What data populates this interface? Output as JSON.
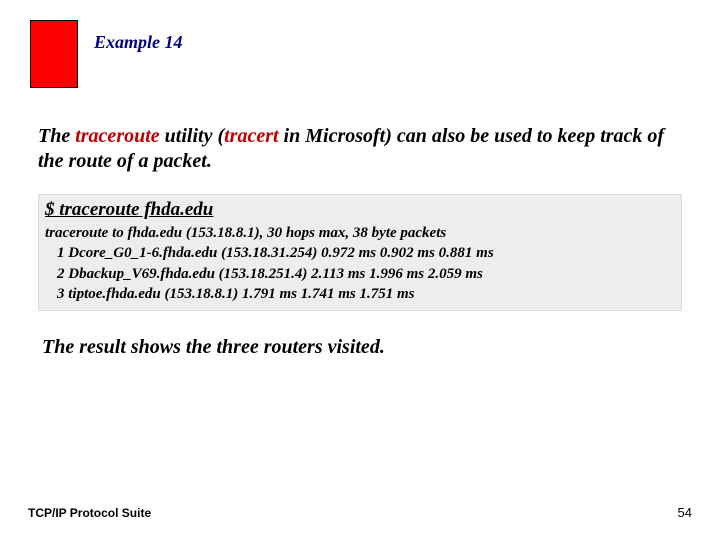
{
  "header": {
    "example_label": "Example 14"
  },
  "intro": {
    "pre": "The ",
    "traceroute_word": "traceroute",
    "mid1": " utility (",
    "tracert_word": "tracert",
    "post": " in Microsoft) can also be used to keep track of the route of a packet."
  },
  "command": {
    "line": "$ traceroute fhda.edu",
    "output_header": "traceroute to fhda.edu (153.18.8.1), 30 hops max, 38 byte packets",
    "hops": [
      "1 Dcore_G0_1-6.fhda.edu (153.18.31.254) 0.972 ms 0.902 ms 0.881 ms",
      "2 Dbackup_V69.fhda.edu (153.18.251.4) 2.113 ms 1.996 ms 2.059 ms",
      "3 tiptoe.fhda.edu (153.18.8.1) 1.791 ms 1.741 ms 1.751 ms"
    ]
  },
  "result": {
    "text": "The result shows the three routers visited."
  },
  "footer": {
    "left": "TCP/IP Protocol Suite",
    "page": "54"
  }
}
